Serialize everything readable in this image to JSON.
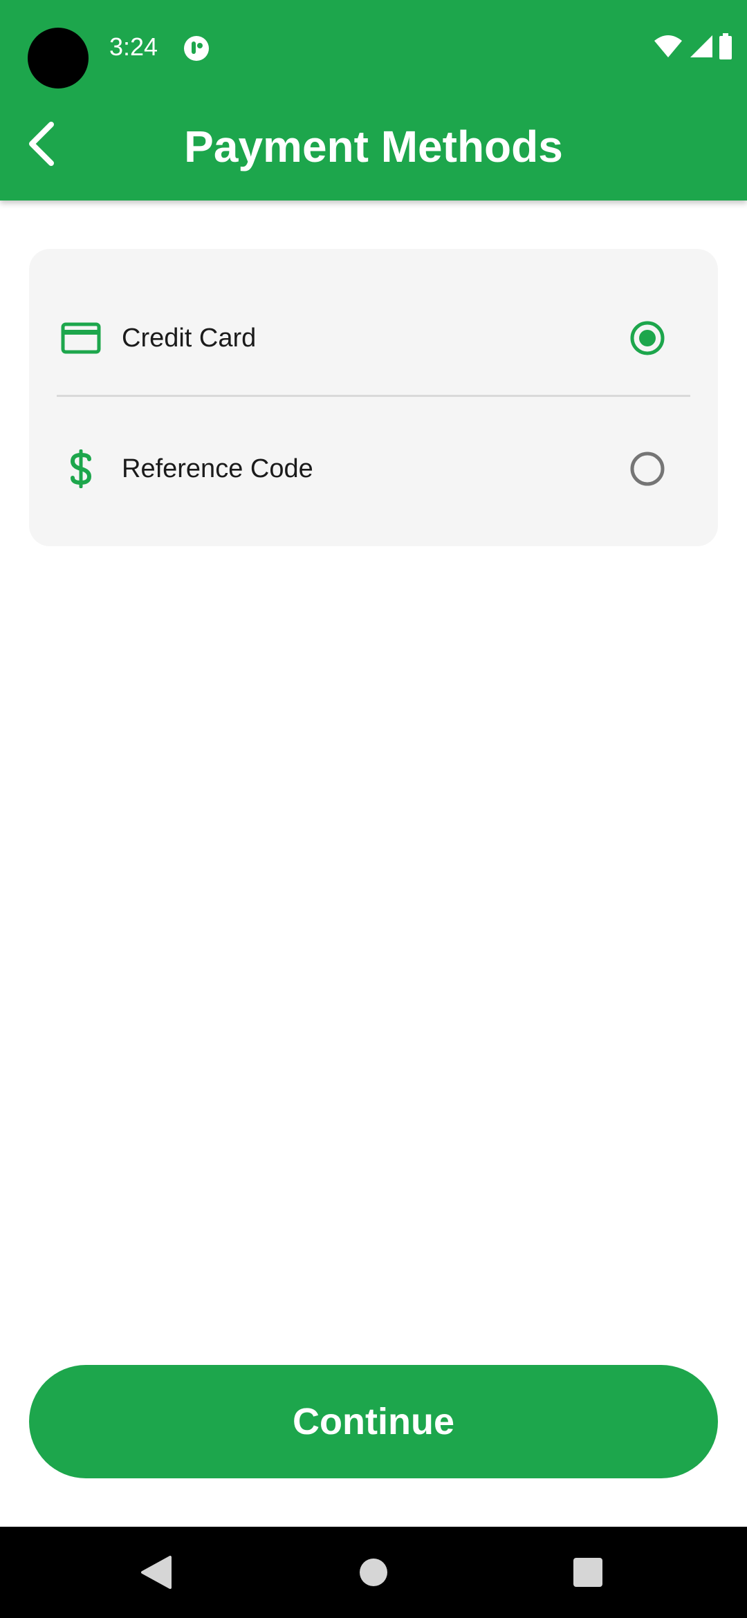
{
  "status_bar": {
    "time": "3:24",
    "icons": [
      "app-notification-icon",
      "wifi-icon",
      "cell-signal-icon",
      "battery-icon"
    ]
  },
  "header": {
    "title": "Payment Methods",
    "back_icon": "chevron-left-icon"
  },
  "payment_options": [
    {
      "label": "Credit Card",
      "icon": "credit-card-icon",
      "selected": true
    },
    {
      "label": "Reference Code",
      "icon": "dollar-icon",
      "selected": false
    }
  ],
  "footer": {
    "continue_label": "Continue"
  },
  "nav_bar": {
    "buttons": [
      "back-nav-icon",
      "home-nav-icon",
      "recents-nav-icon"
    ]
  },
  "colors": {
    "primary": "#1da64c",
    "card_bg": "#f5f5f5",
    "text": "#1b1b1b",
    "radio_unselected": "#757575"
  }
}
